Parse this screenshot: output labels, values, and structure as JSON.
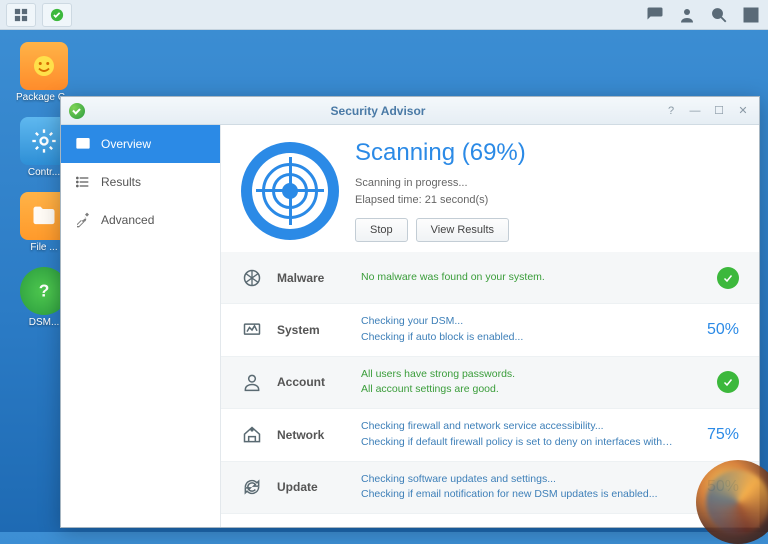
{
  "taskbar": {
    "apps_icon": "apps",
    "shield_icon": "shield"
  },
  "desktop": {
    "icons": [
      {
        "label": "Package C..."
      },
      {
        "label": "Contr..."
      },
      {
        "label": "File ..."
      },
      {
        "label": "DSM..."
      }
    ]
  },
  "window": {
    "title": "Security Advisor"
  },
  "sidebar": {
    "items": [
      {
        "label": "Overview"
      },
      {
        "label": "Results"
      },
      {
        "label": "Advanced"
      }
    ]
  },
  "scan": {
    "heading": "Scanning (69%)",
    "progress_line": "Scanning in progress...",
    "elapsed_line": "Elapsed time: 21 second(s)",
    "stop": "Stop",
    "view_results": "View Results"
  },
  "categories": [
    {
      "name": "Malware",
      "messages": [
        "No malware was found on your system."
      ],
      "msg_class": "ok",
      "status": "check"
    },
    {
      "name": "System",
      "messages": [
        "Checking your DSM...",
        "Checking if auto block is enabled..."
      ],
      "msg_class": "info",
      "status": "50%"
    },
    {
      "name": "Account",
      "messages": [
        "All users have strong passwords.",
        "All account settings are good."
      ],
      "msg_class": "ok",
      "status": "check"
    },
    {
      "name": "Network",
      "messages": [
        "Checking firewall and network service accessibility...",
        "Checking if default firewall policy is set to deny on interfaces with pul..."
      ],
      "msg_class": "info",
      "status": "75%"
    },
    {
      "name": "Update",
      "messages": [
        "Checking software updates and settings...",
        "Checking if email notification for new DSM updates is enabled..."
      ],
      "msg_class": "info",
      "status": "50%"
    }
  ]
}
